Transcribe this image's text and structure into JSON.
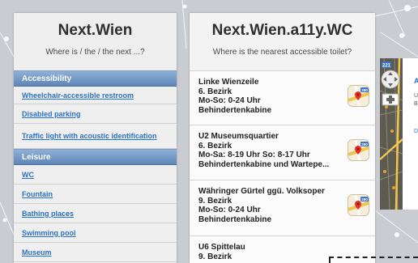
{
  "left": {
    "title": "Next.Wien",
    "subtitle": "Where is / the / the next ...?",
    "sections": [
      {
        "label": "Accessibility",
        "items": [
          "Wheelchair-accessible restroom",
          "Disabled parking",
          "Traffic light with acoustic identification"
        ]
      },
      {
        "label": "Leisure",
        "items": [
          "WC",
          "Fountain",
          "Bathing places",
          "Swimming pool",
          "Museum"
        ]
      }
    ]
  },
  "center": {
    "title": "Next.Wien.a11y.WC",
    "subtitle": "Where is the nearest accessible toilet?",
    "locations": [
      {
        "name": "Linke Wienzeile",
        "district": "6. Bezirk",
        "hours": "Mo-So: 0-24 Uhr",
        "type": "Behindertenkabine"
      },
      {
        "name": "U2 Museumsquartier",
        "district": "6. Bezirk",
        "hours": "Mo-Sa: 8-19 Uhr So: 8-17 Uhr",
        "type": "Behindertenkabine und Wartepe..."
      },
      {
        "name": "Währinger Gürtel ggü. Volksoper",
        "district": "9. Bezirk",
        "hours": "Mo-So: 0-24 Uhr",
        "type": "Behindertenkabine"
      },
      {
        "name": "U6 Spittelau",
        "district": "9. Bezirk",
        "hours": "",
        "type": ""
      }
    ],
    "map_icon_label": "280"
  },
  "map": {
    "shield_label": "221",
    "info_letter": "A",
    "side_letters": [
      "U",
      "B",
      "D"
    ]
  },
  "colors": {
    "section_header": "#6f93c3",
    "link": "#2a72c8",
    "panel_bg": "#eeeeee"
  }
}
